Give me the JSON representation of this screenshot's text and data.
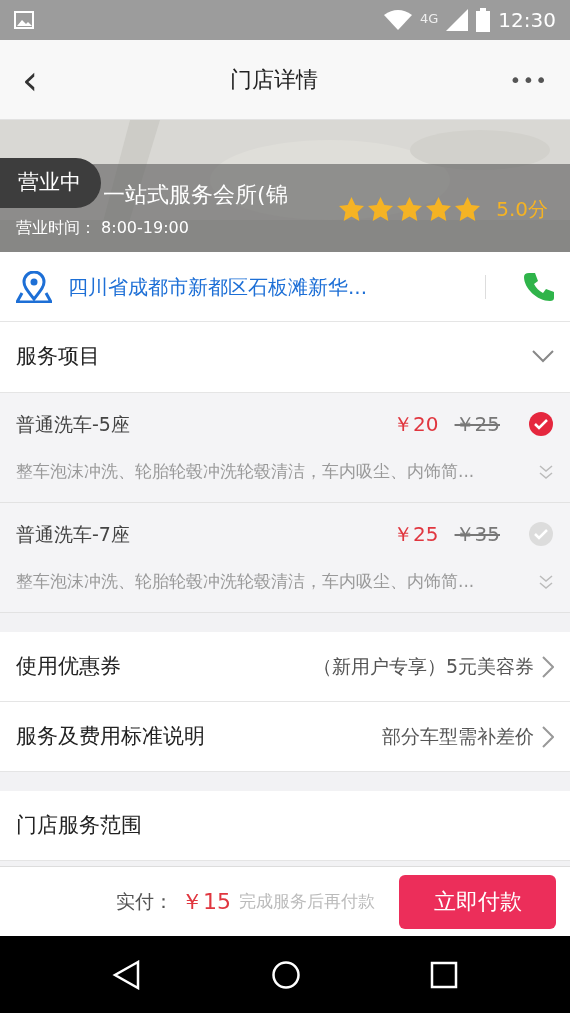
{
  "status_bar": {
    "network": "4G",
    "time": "12:30"
  },
  "header": {
    "back": "‹",
    "title": "门店详情",
    "more": "•••"
  },
  "store": {
    "kind": "picture",
    "badge": "营业中",
    "name": "一站式服务会所(锦",
    "hours": "营业时间： 8:00-19:00",
    "stars": 5,
    "score": "5.0分"
  },
  "address": {
    "text": "四川省成都市新都区石板滩新华..."
  },
  "services": {
    "title": "服务项目",
    "expanded": false,
    "items": [
      {
        "name": "普通洗车-5座",
        "price": "￥20",
        "original_price": "￥25",
        "description": "整车泡沫冲洗、轮胎轮毂冲洗轮毂清洁，车内吸尘、内饰简...",
        "selected": true
      },
      {
        "name": "普通洗车-7座",
        "price": "￥25",
        "original_price": "￥35",
        "description": "整车泡沫冲洗、轮胎轮毂冲洗轮毂清洁，车内吸尘、内饰简...",
        "selected": false
      }
    ]
  },
  "links": [
    {
      "label": "使用优惠券",
      "value": "（新用户专享）5元美容券"
    },
    {
      "label": "服务及费用标准说明",
      "value": "部分车型需补差价"
    }
  ],
  "scope": {
    "title": "门店服务范围"
  },
  "footer": {
    "label": "实付：",
    "amount": "￥15",
    "note": "完成服务后再付款",
    "button": "立即付款"
  }
}
